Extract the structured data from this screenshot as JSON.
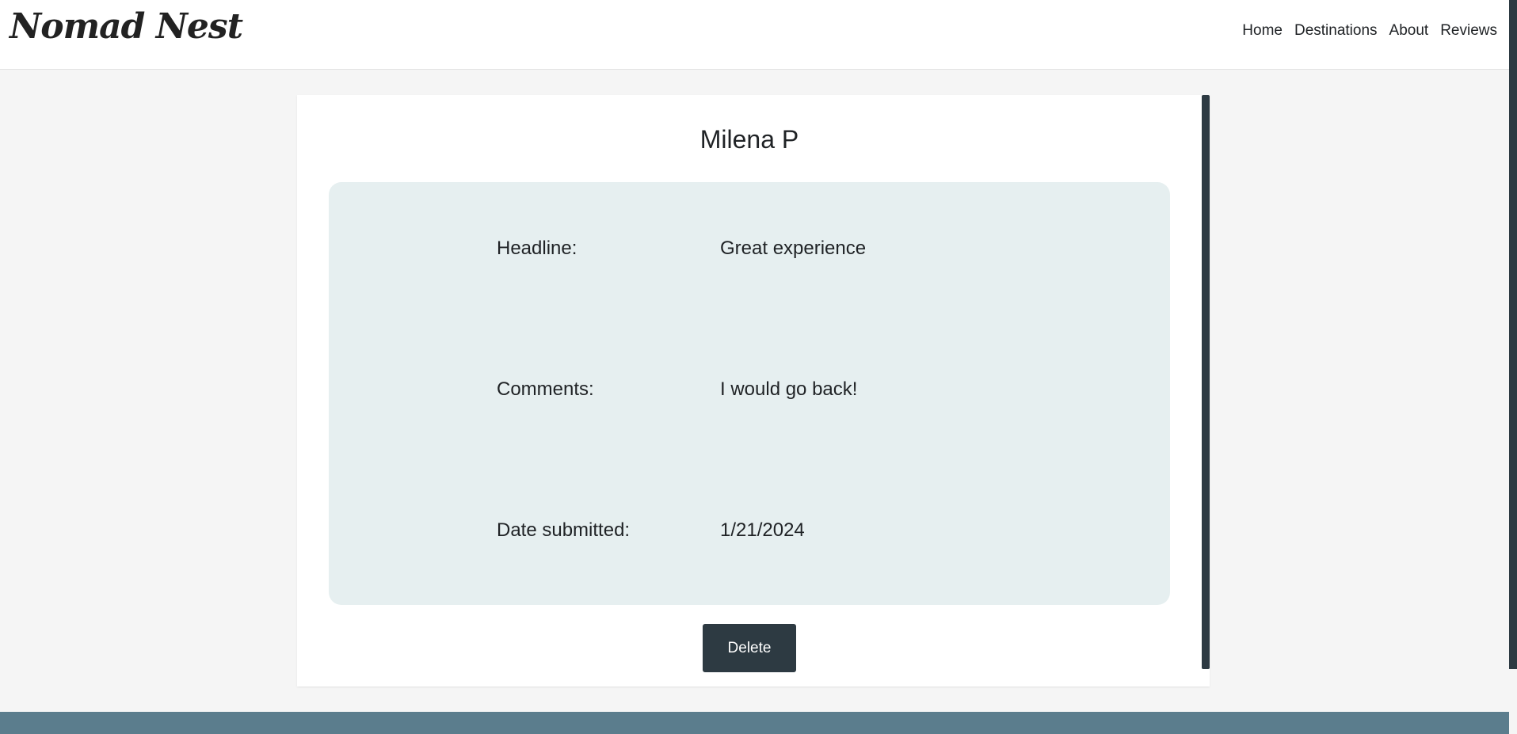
{
  "header": {
    "logo": "Nomad Nest",
    "nav": [
      "Home",
      "Destinations",
      "About",
      "Reviews"
    ]
  },
  "review": {
    "name": "Milena P",
    "fields": [
      {
        "label": "Headline:",
        "value": "Great experience"
      },
      {
        "label": "Comments:",
        "value": "I would go back!"
      },
      {
        "label": "Date submitted:",
        "value": "1/21/2024"
      }
    ],
    "delete_label": "Delete"
  },
  "colors": {
    "page_background": "#f5f5f5",
    "details_background": "#e6eff0",
    "button_background": "#2d3a42",
    "footer_background": "#5b7d8d"
  }
}
